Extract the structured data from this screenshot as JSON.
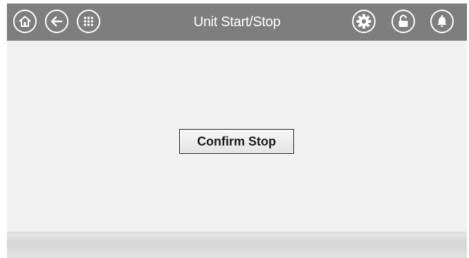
{
  "header": {
    "title": "Unit Start/Stop",
    "left_icons": [
      "home-icon",
      "back-arrow-icon",
      "menu-grid-icon"
    ],
    "right_icons": [
      "gear-icon",
      "unlocked-padlock-icon",
      "bell-icon"
    ]
  },
  "main": {
    "confirm_label": "Confirm Stop"
  },
  "colors": {
    "header_bg": "#7e7e7e",
    "content_bg": "#f2f2f2",
    "icon_stroke": "#ffffff"
  }
}
